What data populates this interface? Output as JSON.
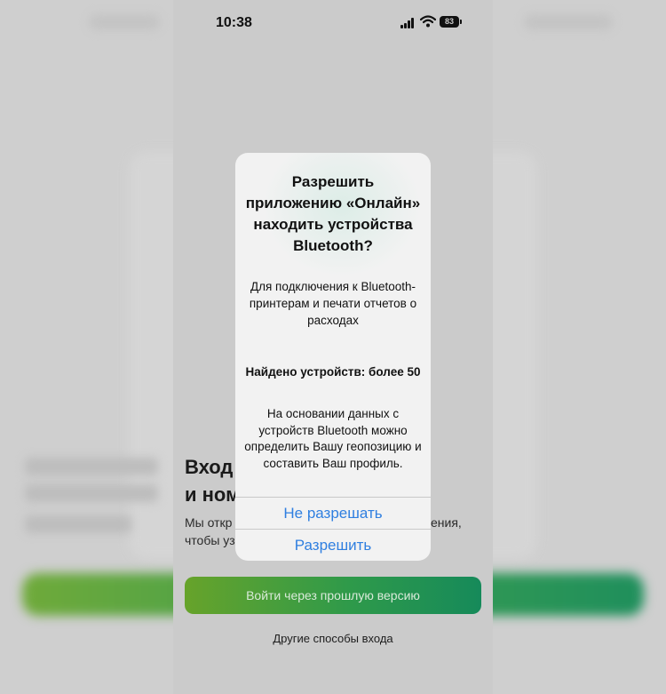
{
  "status_bar": {
    "time": "10:38",
    "battery": "83",
    "icons": [
      "signal-icon",
      "wifi-icon",
      "battery-icon"
    ]
  },
  "background_screen": {
    "title_line1": "Вход",
    "title_line2": "и ном",
    "description_line1": "Мы откр",
    "description_line1_end": "ения,",
    "description_line2": "чтобы уз",
    "login_button": "Войти через прошлую версию",
    "other_login": "Другие способы входа"
  },
  "alert": {
    "title": "Разрешить приложению «Онлайн» находить устройства Bluetooth?",
    "message": "Для подключения к Bluetooth-принтерам и печати отчетов о расходах",
    "found": "Найдено устройств: более 50",
    "note": "На основании данных с устройств Bluetooth можно определить Вашу геопозицию и составить Ваш профиль.",
    "deny_button": "Не разрешать",
    "allow_button": "Разрешить"
  },
  "colors": {
    "accent_blue": "#2f7fe0",
    "green_start": "#67a32a",
    "green_end": "#168a5a",
    "dim_overlay": "#cbcbcb"
  }
}
